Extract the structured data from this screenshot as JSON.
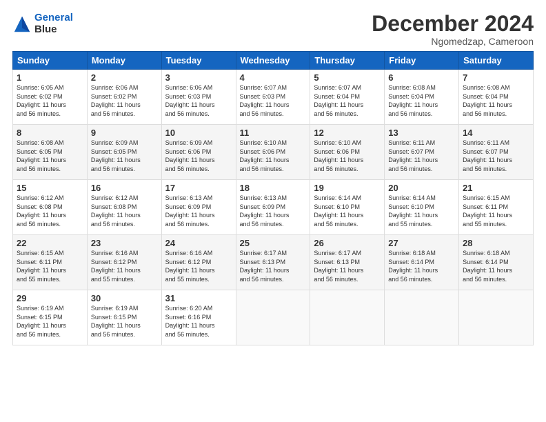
{
  "header": {
    "logo_line1": "General",
    "logo_line2": "Blue",
    "month": "December 2024",
    "location": "Ngomedzap, Cameroon"
  },
  "weekdays": [
    "Sunday",
    "Monday",
    "Tuesday",
    "Wednesday",
    "Thursday",
    "Friday",
    "Saturday"
  ],
  "weeks": [
    [
      {
        "day": "1",
        "info": "Sunrise: 6:05 AM\nSunset: 6:02 PM\nDaylight: 11 hours\nand 56 minutes."
      },
      {
        "day": "2",
        "info": "Sunrise: 6:06 AM\nSunset: 6:02 PM\nDaylight: 11 hours\nand 56 minutes."
      },
      {
        "day": "3",
        "info": "Sunrise: 6:06 AM\nSunset: 6:03 PM\nDaylight: 11 hours\nand 56 minutes."
      },
      {
        "day": "4",
        "info": "Sunrise: 6:07 AM\nSunset: 6:03 PM\nDaylight: 11 hours\nand 56 minutes."
      },
      {
        "day": "5",
        "info": "Sunrise: 6:07 AM\nSunset: 6:04 PM\nDaylight: 11 hours\nand 56 minutes."
      },
      {
        "day": "6",
        "info": "Sunrise: 6:08 AM\nSunset: 6:04 PM\nDaylight: 11 hours\nand 56 minutes."
      },
      {
        "day": "7",
        "info": "Sunrise: 6:08 AM\nSunset: 6:04 PM\nDaylight: 11 hours\nand 56 minutes."
      }
    ],
    [
      {
        "day": "8",
        "info": "Sunrise: 6:08 AM\nSunset: 6:05 PM\nDaylight: 11 hours\nand 56 minutes."
      },
      {
        "day": "9",
        "info": "Sunrise: 6:09 AM\nSunset: 6:05 PM\nDaylight: 11 hours\nand 56 minutes."
      },
      {
        "day": "10",
        "info": "Sunrise: 6:09 AM\nSunset: 6:06 PM\nDaylight: 11 hours\nand 56 minutes."
      },
      {
        "day": "11",
        "info": "Sunrise: 6:10 AM\nSunset: 6:06 PM\nDaylight: 11 hours\nand 56 minutes."
      },
      {
        "day": "12",
        "info": "Sunrise: 6:10 AM\nSunset: 6:06 PM\nDaylight: 11 hours\nand 56 minutes."
      },
      {
        "day": "13",
        "info": "Sunrise: 6:11 AM\nSunset: 6:07 PM\nDaylight: 11 hours\nand 56 minutes."
      },
      {
        "day": "14",
        "info": "Sunrise: 6:11 AM\nSunset: 6:07 PM\nDaylight: 11 hours\nand 56 minutes."
      }
    ],
    [
      {
        "day": "15",
        "info": "Sunrise: 6:12 AM\nSunset: 6:08 PM\nDaylight: 11 hours\nand 56 minutes."
      },
      {
        "day": "16",
        "info": "Sunrise: 6:12 AM\nSunset: 6:08 PM\nDaylight: 11 hours\nand 56 minutes."
      },
      {
        "day": "17",
        "info": "Sunrise: 6:13 AM\nSunset: 6:09 PM\nDaylight: 11 hours\nand 56 minutes."
      },
      {
        "day": "18",
        "info": "Sunrise: 6:13 AM\nSunset: 6:09 PM\nDaylight: 11 hours\nand 56 minutes."
      },
      {
        "day": "19",
        "info": "Sunrise: 6:14 AM\nSunset: 6:10 PM\nDaylight: 11 hours\nand 56 minutes."
      },
      {
        "day": "20",
        "info": "Sunrise: 6:14 AM\nSunset: 6:10 PM\nDaylight: 11 hours\nand 55 minutes."
      },
      {
        "day": "21",
        "info": "Sunrise: 6:15 AM\nSunset: 6:11 PM\nDaylight: 11 hours\nand 55 minutes."
      }
    ],
    [
      {
        "day": "22",
        "info": "Sunrise: 6:15 AM\nSunset: 6:11 PM\nDaylight: 11 hours\nand 55 minutes."
      },
      {
        "day": "23",
        "info": "Sunrise: 6:16 AM\nSunset: 6:12 PM\nDaylight: 11 hours\nand 55 minutes."
      },
      {
        "day": "24",
        "info": "Sunrise: 6:16 AM\nSunset: 6:12 PM\nDaylight: 11 hours\nand 55 minutes."
      },
      {
        "day": "25",
        "info": "Sunrise: 6:17 AM\nSunset: 6:13 PM\nDaylight: 11 hours\nand 56 minutes."
      },
      {
        "day": "26",
        "info": "Sunrise: 6:17 AM\nSunset: 6:13 PM\nDaylight: 11 hours\nand 56 minutes."
      },
      {
        "day": "27",
        "info": "Sunrise: 6:18 AM\nSunset: 6:14 PM\nDaylight: 11 hours\nand 56 minutes."
      },
      {
        "day": "28",
        "info": "Sunrise: 6:18 AM\nSunset: 6:14 PM\nDaylight: 11 hours\nand 56 minutes."
      }
    ],
    [
      {
        "day": "29",
        "info": "Sunrise: 6:19 AM\nSunset: 6:15 PM\nDaylight: 11 hours\nand 56 minutes."
      },
      {
        "day": "30",
        "info": "Sunrise: 6:19 AM\nSunset: 6:15 PM\nDaylight: 11 hours\nand 56 minutes."
      },
      {
        "day": "31",
        "info": "Sunrise: 6:20 AM\nSunset: 6:16 PM\nDaylight: 11 hours\nand 56 minutes."
      },
      {
        "day": "",
        "info": ""
      },
      {
        "day": "",
        "info": ""
      },
      {
        "day": "",
        "info": ""
      },
      {
        "day": "",
        "info": ""
      }
    ]
  ]
}
